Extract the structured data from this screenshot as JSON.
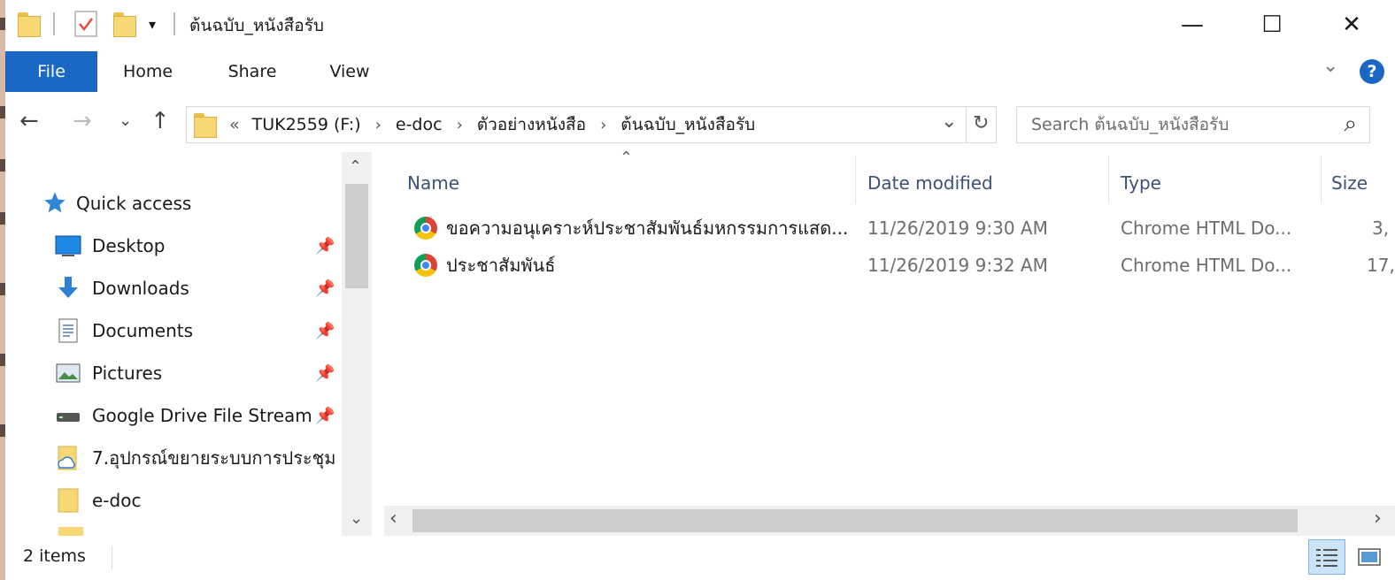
{
  "window": {
    "title": "ต้นฉบับ_หนังสือรับ",
    "minimize_glyph": "—",
    "maximize_glyph": "☐",
    "close_glyph": "✕"
  },
  "ribbon": {
    "tabs": [
      "File",
      "Home",
      "Share",
      "View"
    ],
    "help_glyph": "?",
    "expand_glyph": "⌄"
  },
  "nav": {
    "back_glyph": "←",
    "forward_glyph": "→",
    "recent_glyph": "⌄",
    "up_glyph": "↑"
  },
  "address": {
    "overflow": "«",
    "crumbs": [
      "TUK2559 (F:)",
      "e-doc",
      "ตัวอย่างหนังสือ",
      "ต้นฉบับ_หนังสือรับ"
    ],
    "separator": "›",
    "dropdown_glyph": "⌄",
    "refresh_glyph": "↻"
  },
  "search": {
    "placeholder": "Search ต้นฉบับ_หนังสือรับ",
    "icon_glyph": "⌕"
  },
  "navpane": {
    "quick_access": "Quick access",
    "items": [
      {
        "label": "Desktop",
        "icon": "desktop-icon",
        "pinned": true
      },
      {
        "label": "Downloads",
        "icon": "downloads-icon",
        "pinned": true
      },
      {
        "label": "Documents",
        "icon": "documents-icon",
        "pinned": true
      },
      {
        "label": "Pictures",
        "icon": "pictures-icon",
        "pinned": true
      },
      {
        "label": "Google Drive File Stream",
        "icon": "drive-icon",
        "pinned": true
      },
      {
        "label": "7.อุปกรณ์ขยายระบบการประชุม",
        "icon": "cloud-folder-icon",
        "pinned": false
      },
      {
        "label": "e-doc",
        "icon": "folder-icon",
        "pinned": false
      }
    ],
    "pin_glyph": "📌"
  },
  "columns": {
    "name": "Name",
    "date": "Date modified",
    "type": "Type",
    "size": "Size"
  },
  "files": [
    {
      "name": "ขอความอนุเคราะห์ประชาสัมพันธ์มหกรรมการแสด...",
      "date": "11/26/2019 9:30 AM",
      "type": "Chrome HTML Do...",
      "size": "3,"
    },
    {
      "name": "ประชาสัมพันธ์",
      "date": "11/26/2019 9:32 AM",
      "type": "Chrome HTML Do...",
      "size": "17,"
    }
  ],
  "status": {
    "count": "2 items"
  }
}
